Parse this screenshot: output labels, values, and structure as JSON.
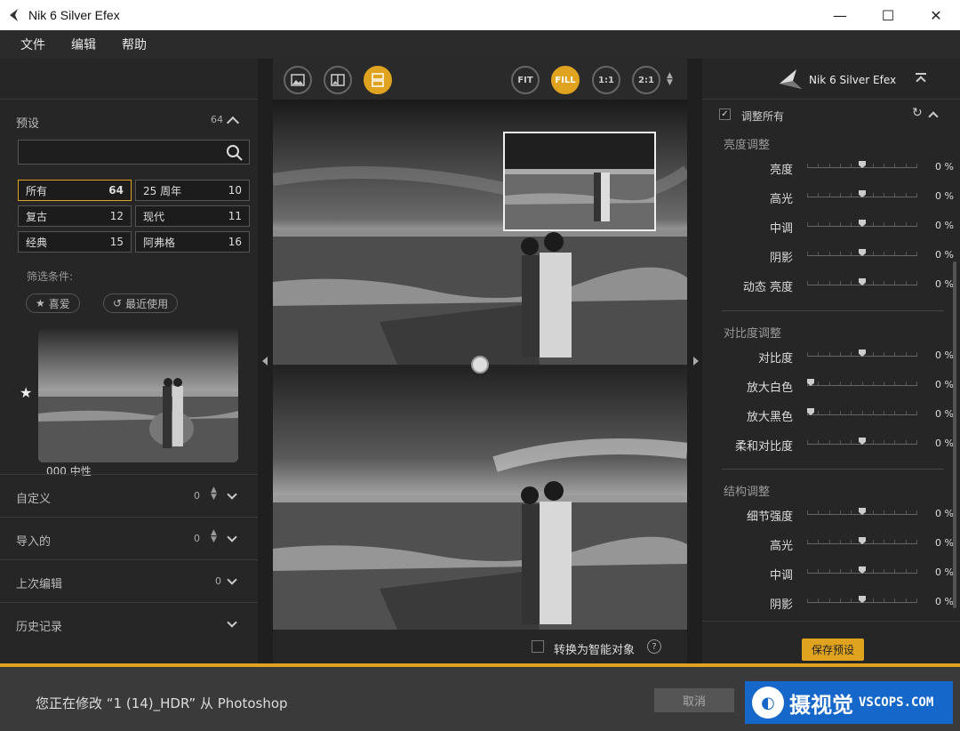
{
  "window": {
    "title": "Nik 6 Silver Efex",
    "minimize": "—",
    "maximize": "☐",
    "close": "✕"
  },
  "menu": {
    "file": "文件",
    "edit": "编辑",
    "help": "帮助"
  },
  "left": {
    "presets_label": "预设",
    "presets_count": "64",
    "search_placeholder": "",
    "categories": [
      {
        "label": "所有",
        "count": "64"
      },
      {
        "label": "25 周年",
        "count": "10"
      },
      {
        "label": "复古",
        "count": "12"
      },
      {
        "label": "现代",
        "count": "11"
      },
      {
        "label": "经典",
        "count": "15"
      },
      {
        "label": "阿弗格",
        "count": "16"
      }
    ],
    "filter_label": "筛选条件:",
    "filter_fav": "喜爱",
    "filter_recent": "最近使用",
    "thumb_name": "000 中性",
    "sections": [
      {
        "label": "自定义",
        "count": "0"
      },
      {
        "label": "导入的",
        "count": "0"
      },
      {
        "label": "上次编辑",
        "count": "0"
      },
      {
        "label": "历史记录",
        "count": ""
      }
    ]
  },
  "toolbar": {
    "fit": "FIT",
    "fill": "FILL",
    "one": "1:1",
    "two": "2:1"
  },
  "center": {
    "smart_object": "转换为智能对象",
    "help": "?"
  },
  "right": {
    "brand": "Nik 6 Silver Efex",
    "adjust_all": "调整所有",
    "groups": [
      {
        "title": "亮度调整",
        "rows": [
          {
            "label": "亮度",
            "value": "0 %",
            "level": 0.5
          },
          {
            "label": "高光",
            "value": "0 %",
            "level": 0.5
          },
          {
            "label": "中调",
            "value": "0 %",
            "level": 0.5
          },
          {
            "label": "阴影",
            "value": "0 %",
            "level": 0.5
          },
          {
            "label": "动态 亮度",
            "value": "0 %",
            "level": 0.5
          }
        ]
      },
      {
        "title": "对比度调整",
        "rows": [
          {
            "label": "对比度",
            "value": "0 %",
            "level": 0.5
          },
          {
            "label": "放大白色",
            "value": "0 %",
            "level": 0
          },
          {
            "label": "放大黑色",
            "value": "0 %",
            "level": 0
          },
          {
            "label": "柔和对比度",
            "value": "0 %",
            "level": 0.5
          }
        ]
      },
      {
        "title": "结构调整",
        "rows": [
          {
            "label": "细节强度",
            "value": "0 %",
            "level": 0.5
          },
          {
            "label": "高光",
            "value": "0 %",
            "level": 0.5
          },
          {
            "label": "中调",
            "value": "0 %",
            "level": 0.5
          },
          {
            "label": "阴影",
            "value": "0 %",
            "level": 0.5
          }
        ]
      }
    ],
    "save_preset": "保存预设"
  },
  "footer": {
    "message": "您正在修改 “1 (14)_HDR” 从 Photoshop",
    "cancel": "取消",
    "watermark_cn": "摄视觉",
    "watermark_en": "VSCOPS.COM"
  },
  "colors": {
    "accent": "#e0a31f",
    "watermark": "#1568c9"
  }
}
